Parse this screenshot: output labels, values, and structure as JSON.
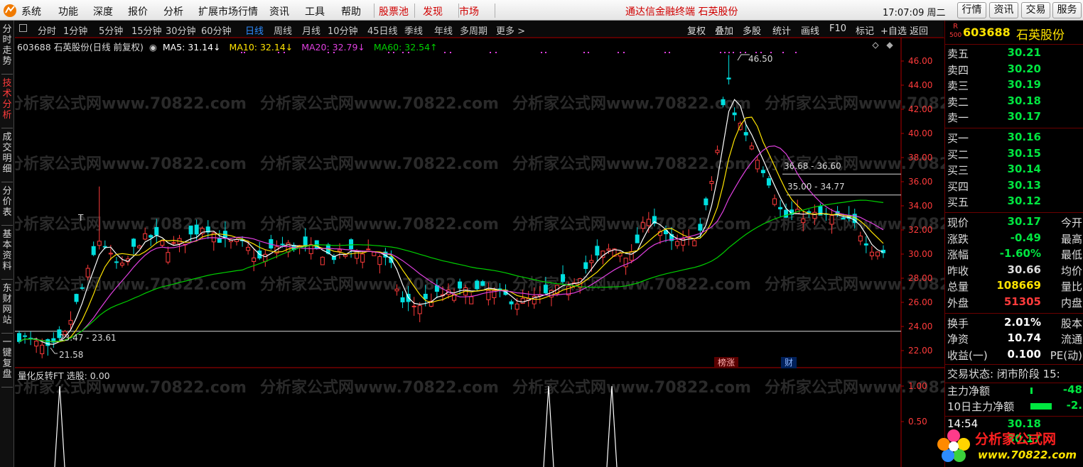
{
  "menubar": {
    "items": [
      "系统",
      "功能",
      "深度",
      "报价",
      "分析",
      "扩展市场行情",
      "资讯",
      "工具",
      "帮助"
    ],
    "red_items": [
      "股票池",
      "发现",
      "市场"
    ],
    "center_text": "通达信金融终端  石英股份",
    "clock": "17:07:09 周二",
    "buttons": [
      "行情",
      "资讯",
      "交易",
      "服务"
    ]
  },
  "side_tabs": [
    "分时走势",
    "技术分析",
    "成交明细",
    "分价表",
    "基本资料",
    "东财网站",
    "一键复盘"
  ],
  "side_active": "技术分析",
  "toolbar": {
    "periods": [
      "分时",
      "1分钟",
      "5分钟",
      "15分钟",
      "30分钟",
      "60分钟",
      "日线",
      "周线",
      "月线",
      "10分钟",
      "45日线",
      "季线",
      "年线",
      "多周期",
      "更多 >"
    ],
    "active_period": "日线",
    "right": [
      "复权",
      "叠加",
      "多股",
      "统计",
      "画线",
      "F10",
      "标记",
      "+自选",
      "返回"
    ]
  },
  "info": {
    "title": "603688 石英股份(日线 前复权)",
    "ma5": "MA5: 31.14↓",
    "ma10": "MA10: 32.14↓",
    "ma20": "MA20: 32.79↓",
    "ma60": "MA60: 32.54↑"
  },
  "chart": {
    "y_ticks": [
      "46.00",
      "44.00",
      "42.00",
      "40.00",
      "38.00",
      "36.00",
      "34.00",
      "32.00",
      "30.00",
      "28.00",
      "26.00",
      "24.00",
      "22.00"
    ],
    "annotations": {
      "high": "46.50",
      "low": "21.58",
      "range1": "36.68 - 36.60",
      "range2": "35.00 - 34.77",
      "range3": "23.47 - 23.61",
      "t_mark": "T"
    },
    "badges": [
      "榜涨",
      "财"
    ],
    "colors": {
      "up": "#ff3b3b",
      "down": "#00e0e0",
      "ma5": "#ffffff",
      "ma10": "#ffe400",
      "ma20": "#e040e0",
      "ma60": "#00d000",
      "axis": "#b00000"
    }
  },
  "indicator": {
    "title": "量化反转FT 选股: 0.00",
    "y_ticks": [
      "1.00",
      "0.50"
    ]
  },
  "quote": {
    "code": "603688",
    "name": "石英股份",
    "r_label": "R",
    "r_num": "500",
    "asks": [
      {
        "label": "卖五",
        "price": "30.21"
      },
      {
        "label": "卖四",
        "price": "30.20"
      },
      {
        "label": "卖三",
        "price": "30.19"
      },
      {
        "label": "卖二",
        "price": "30.18"
      },
      {
        "label": "卖一",
        "price": "30.17"
      }
    ],
    "bids": [
      {
        "label": "买一",
        "price": "30.16"
      },
      {
        "label": "买二",
        "price": "30.15"
      },
      {
        "label": "买三",
        "price": "30.14"
      },
      {
        "label": "买四",
        "price": "30.13"
      },
      {
        "label": "买五",
        "price": "30.12"
      }
    ],
    "stats": [
      {
        "l": "现价",
        "v": "30.17",
        "r": "今开",
        "c": "g"
      },
      {
        "l": "涨跌",
        "v": "-0.49",
        "r": "最高",
        "c": "g"
      },
      {
        "l": "涨幅",
        "v": "-1.60%",
        "r": "最低",
        "c": "g"
      },
      {
        "l": "昨收",
        "v": "30.66",
        "r": "均价",
        "c": "w"
      },
      {
        "l": "总量",
        "v": "108669",
        "r": "量比",
        "c": "y"
      },
      {
        "l": "外盘",
        "v": "51305",
        "r": "内盘",
        "c": "r"
      }
    ],
    "stats2": [
      {
        "l": "换手",
        "v": "2.01%",
        "r": "股本"
      },
      {
        "l": "净资",
        "v": "10.74",
        "r": "流通"
      },
      {
        "l": "收益(一)",
        "v": "0.100",
        "r": "PE(动)"
      }
    ],
    "trade_status": "交易状态: 闭市阶段 15:",
    "main_flow": "主力净额",
    "main_flow_val": "-48",
    "flow10": "10日主力净额",
    "flow10_val": "-2.",
    "ticks": [
      {
        "t": "14:54",
        "p": "30.18"
      },
      {
        "t": "",
        "p": "30.17"
      }
    ]
  },
  "watermark": {
    "brand": "分析家公式网",
    "url": "www.70822.com",
    "bg_text": "分析家公式网www.70822.com"
  }
}
